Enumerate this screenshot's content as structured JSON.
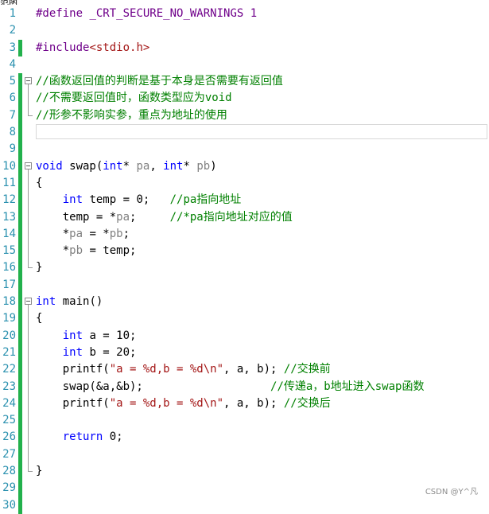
{
  "top_fragment": "范函",
  "watermark": "CSDN @Y^凡",
  "lines": [
    {
      "n": "1",
      "changed": false,
      "fold": "none",
      "tokens": [
        {
          "t": "#define",
          "c": "pp"
        },
        {
          "t": " _CRT_SECURE_NO_WARNINGS 1",
          "c": "pp"
        }
      ]
    },
    {
      "n": "2",
      "changed": false,
      "fold": "none",
      "tokens": []
    },
    {
      "n": "3",
      "changed": true,
      "fold": "none",
      "tokens": [
        {
          "t": "#include",
          "c": "pp"
        },
        {
          "t": "<stdio.h>",
          "c": "str"
        }
      ]
    },
    {
      "n": "4",
      "changed": false,
      "fold": "none",
      "tokens": []
    },
    {
      "n": "5",
      "changed": true,
      "fold": "start",
      "tokens": [
        {
          "t": "//函数返回值的判断是基于本身是否需要有返回值",
          "c": "cmt"
        }
      ]
    },
    {
      "n": "6",
      "changed": true,
      "fold": "mid",
      "tokens": [
        {
          "t": "//不需要返回值时，函数类型应为void",
          "c": "cmt"
        }
      ]
    },
    {
      "n": "7",
      "changed": true,
      "fold": "end",
      "tokens": [
        {
          "t": "//形参不影响实参，重点为地址的使用",
          "c": "cmt"
        }
      ]
    },
    {
      "n": "8",
      "changed": true,
      "fold": "none",
      "current": true,
      "tokens": []
    },
    {
      "n": "9",
      "changed": true,
      "fold": "none",
      "tokens": []
    },
    {
      "n": "10",
      "changed": true,
      "fold": "start",
      "tokens": [
        {
          "t": "void",
          "c": "kw"
        },
        {
          "t": " swap(",
          "c": ""
        },
        {
          "t": "int",
          "c": "kw"
        },
        {
          "t": "* ",
          "c": ""
        },
        {
          "t": "pa",
          "c": "param"
        },
        {
          "t": ", ",
          "c": ""
        },
        {
          "t": "int",
          "c": "kw"
        },
        {
          "t": "* ",
          "c": ""
        },
        {
          "t": "pb",
          "c": "param"
        },
        {
          "t": ")",
          "c": ""
        }
      ]
    },
    {
      "n": "11",
      "changed": true,
      "fold": "mid",
      "tokens": [
        {
          "t": "{",
          "c": ""
        }
      ]
    },
    {
      "n": "12",
      "changed": true,
      "fold": "mid",
      "tokens": [
        {
          "t": "    ",
          "c": ""
        },
        {
          "t": "int",
          "c": "kw"
        },
        {
          "t": " temp = 0;   ",
          "c": ""
        },
        {
          "t": "//pa指向地址",
          "c": "cmt"
        }
      ]
    },
    {
      "n": "13",
      "changed": true,
      "fold": "mid",
      "tokens": [
        {
          "t": "    temp = *",
          "c": ""
        },
        {
          "t": "pa",
          "c": "param"
        },
        {
          "t": ";     ",
          "c": ""
        },
        {
          "t": "//*pa指向地址对应的值",
          "c": "cmt"
        }
      ]
    },
    {
      "n": "14",
      "changed": true,
      "fold": "mid",
      "tokens": [
        {
          "t": "    *",
          "c": ""
        },
        {
          "t": "pa",
          "c": "param"
        },
        {
          "t": " = *",
          "c": ""
        },
        {
          "t": "pb",
          "c": "param"
        },
        {
          "t": ";",
          "c": ""
        }
      ]
    },
    {
      "n": "15",
      "changed": true,
      "fold": "mid",
      "tokens": [
        {
          "t": "    *",
          "c": ""
        },
        {
          "t": "pb",
          "c": "param"
        },
        {
          "t": " = temp;",
          "c": ""
        }
      ]
    },
    {
      "n": "16",
      "changed": true,
      "fold": "end",
      "tokens": [
        {
          "t": "}",
          "c": ""
        }
      ]
    },
    {
      "n": "17",
      "changed": true,
      "fold": "none",
      "tokens": []
    },
    {
      "n": "18",
      "changed": true,
      "fold": "start",
      "tokens": [
        {
          "t": "int",
          "c": "kw"
        },
        {
          "t": " main()",
          "c": ""
        }
      ]
    },
    {
      "n": "19",
      "changed": true,
      "fold": "mid",
      "tokens": [
        {
          "t": "{",
          "c": ""
        }
      ]
    },
    {
      "n": "20",
      "changed": true,
      "fold": "mid",
      "tokens": [
        {
          "t": "    ",
          "c": ""
        },
        {
          "t": "int",
          "c": "kw"
        },
        {
          "t": " a = 10;",
          "c": ""
        }
      ]
    },
    {
      "n": "21",
      "changed": true,
      "fold": "mid",
      "tokens": [
        {
          "t": "    ",
          "c": ""
        },
        {
          "t": "int",
          "c": "kw"
        },
        {
          "t": " b = 20;",
          "c": ""
        }
      ]
    },
    {
      "n": "22",
      "changed": true,
      "fold": "mid",
      "tokens": [
        {
          "t": "    printf(",
          "c": ""
        },
        {
          "t": "\"a = %d,b = %d\\n\"",
          "c": "str"
        },
        {
          "t": ", a, b); ",
          "c": ""
        },
        {
          "t": "//交换前",
          "c": "cmt"
        }
      ]
    },
    {
      "n": "23",
      "changed": true,
      "fold": "mid",
      "tokens": [
        {
          "t": "    swap(&a,&b);                   ",
          "c": ""
        },
        {
          "t": "//传递a，b地址进入swap函数",
          "c": "cmt"
        }
      ]
    },
    {
      "n": "24",
      "changed": true,
      "fold": "mid",
      "tokens": [
        {
          "t": "    printf(",
          "c": ""
        },
        {
          "t": "\"a = %d,b = %d\\n\"",
          "c": "str"
        },
        {
          "t": ", a, b); ",
          "c": ""
        },
        {
          "t": "//交换后",
          "c": "cmt"
        }
      ]
    },
    {
      "n": "25",
      "changed": true,
      "fold": "mid",
      "tokens": []
    },
    {
      "n": "26",
      "changed": true,
      "fold": "mid",
      "tokens": [
        {
          "t": "    ",
          "c": ""
        },
        {
          "t": "return",
          "c": "kw"
        },
        {
          "t": " 0;",
          "c": ""
        }
      ]
    },
    {
      "n": "27",
      "changed": true,
      "fold": "mid",
      "tokens": []
    },
    {
      "n": "28",
      "changed": true,
      "fold": "end",
      "tokens": [
        {
          "t": "}",
          "c": ""
        }
      ]
    },
    {
      "n": "29",
      "changed": true,
      "fold": "none",
      "tokens": []
    },
    {
      "n": "30",
      "changed": true,
      "fold": "none",
      "tokens": []
    }
  ]
}
